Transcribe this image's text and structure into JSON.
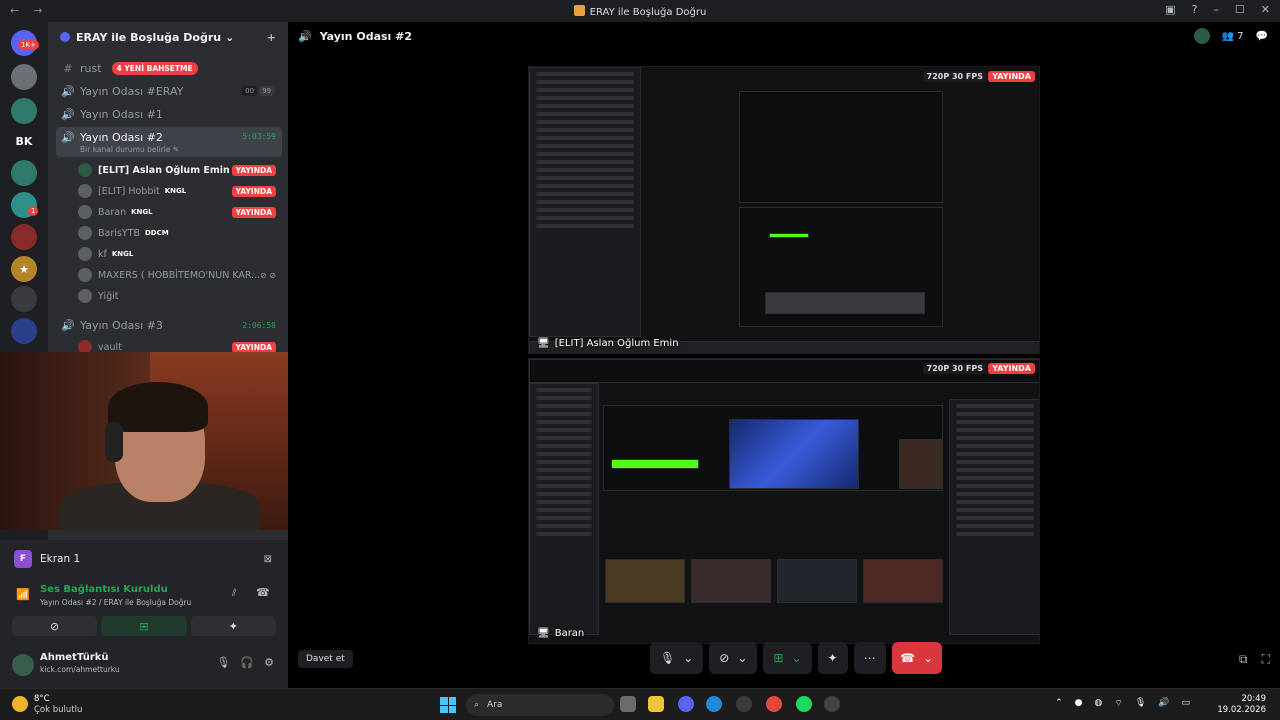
{
  "window": {
    "title": "ERAY ile Boşluğa Doğru",
    "back": "←",
    "forward": "→",
    "min": "–",
    "max": "☐",
    "close": "✕",
    "help": "?"
  },
  "rail": {
    "badge_top": "1K+",
    "bk": "BK",
    "badge_small": "1"
  },
  "server": {
    "name": "ERAY ile Boşluğa Doğru",
    "chevron": "⌄",
    "add_icon": "+"
  },
  "channels": [
    {
      "icon": "#",
      "name": "rust",
      "pill": "4 YENİ BAHSETME"
    },
    {
      "icon": "🔊",
      "name": "Yayın Odası #ERAY",
      "counts": [
        "00",
        "99"
      ]
    },
    {
      "icon": "🔊",
      "name": "Yayın Odası #1"
    },
    {
      "icon": "🔊",
      "name": "Yayın Odası #2",
      "time": "5:03:59",
      "status": "Bir kanal durumu belirle ✎"
    },
    {
      "icon": "🔊",
      "name": "Yayın Odası #3",
      "time": "2:06:58"
    }
  ],
  "voice_users": [
    {
      "name": "[ELIT] Aslan Oğlum Emin",
      "tag": "",
      "live": "YAYINDA",
      "on": true
    },
    {
      "name": "[ELIT] Hobbit",
      "tag": "KNGL",
      "live": "YAYINDA",
      "on": false
    },
    {
      "name": "Baran",
      "tag": "KNGL",
      "live": "YAYINDA",
      "on": false
    },
    {
      "name": "BarisYTB",
      "tag": "DDCM",
      "live": "",
      "on": false
    },
    {
      "name": "kf",
      "tag": "KNGL",
      "live": "",
      "on": false
    },
    {
      "name": "MAXERS ( HOBBİTEMO'NUN KAR...",
      "tag": "",
      "live": "",
      "on": false
    },
    {
      "name": "Yiğit",
      "tag": "",
      "live": "",
      "on": false
    }
  ],
  "room3_user": {
    "name": "vault",
    "live": "YAYINDA"
  },
  "panel": {
    "share_letter": "F",
    "share_title": "Ekran 1",
    "voice_connected": "Ses Bağlantısı Kuruldu",
    "voice_sub": "Yayın Odası #2 / ERAY ile Boşluğa Doğru",
    "user_name": "AhmetTürkü",
    "user_status": "kick.com/ahmetturku"
  },
  "stage": {
    "title": "Yayın Odası #2",
    "people_count": "7",
    "invite": "Davet et",
    "tiles": [
      {
        "quality": "720P 30 FPS",
        "live": "YAYINDA",
        "name": "[ELIT] Aslan Oğlum Emin"
      },
      {
        "quality": "720P 30 FPS",
        "live": "YAYINDA",
        "name": "Baran"
      }
    ]
  },
  "taskbar": {
    "temp": "8°C",
    "weather": "Çok bulutlu",
    "search": "Ara",
    "time": "20:49",
    "date": "19.02.2026"
  }
}
